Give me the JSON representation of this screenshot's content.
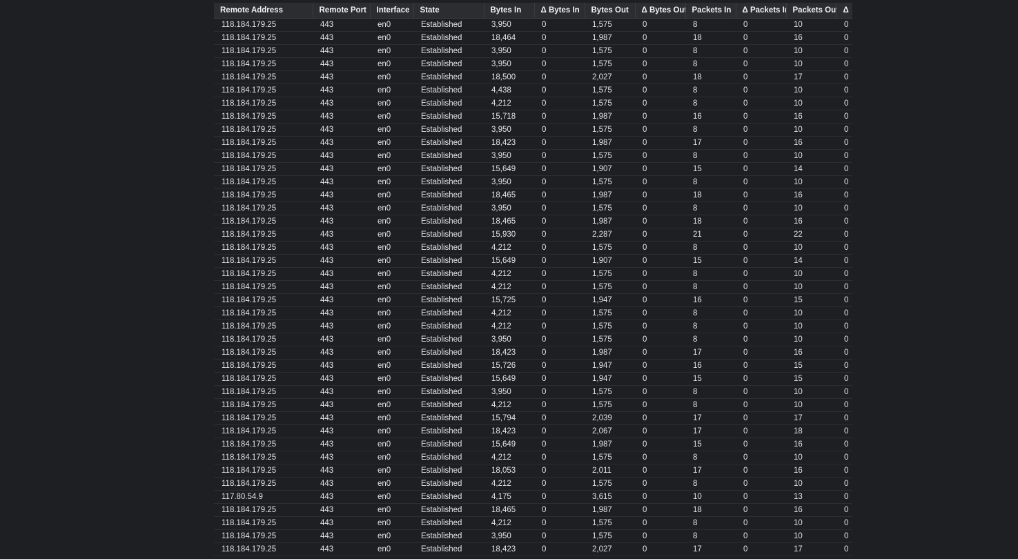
{
  "table": {
    "columns": [
      "Remote Address",
      "Remote Port",
      "Interface",
      "State",
      "Bytes In",
      "Δ Bytes In",
      "Bytes Out",
      "Δ Bytes Out",
      "Packets In",
      "Δ Packets In",
      "Packets Out",
      "Δ"
    ],
    "rows": [
      [
        "118.184.179.25",
        "443",
        "en0",
        "Established",
        "3,950",
        "0",
        "1,575",
        "0",
        "8",
        "0",
        "10",
        "0"
      ],
      [
        "118.184.179.25",
        "443",
        "en0",
        "Established",
        "18,464",
        "0",
        "1,987",
        "0",
        "18",
        "0",
        "16",
        "0"
      ],
      [
        "118.184.179.25",
        "443",
        "en0",
        "Established",
        "3,950",
        "0",
        "1,575",
        "0",
        "8",
        "0",
        "10",
        "0"
      ],
      [
        "118.184.179.25",
        "443",
        "en0",
        "Established",
        "3,950",
        "0",
        "1,575",
        "0",
        "8",
        "0",
        "10",
        "0"
      ],
      [
        "118.184.179.25",
        "443",
        "en0",
        "Established",
        "18,500",
        "0",
        "2,027",
        "0",
        "18",
        "0",
        "17",
        "0"
      ],
      [
        "118.184.179.25",
        "443",
        "en0",
        "Established",
        "4,438",
        "0",
        "1,575",
        "0",
        "8",
        "0",
        "10",
        "0"
      ],
      [
        "118.184.179.25",
        "443",
        "en0",
        "Established",
        "4,212",
        "0",
        "1,575",
        "0",
        "8",
        "0",
        "10",
        "0"
      ],
      [
        "118.184.179.25",
        "443",
        "en0",
        "Established",
        "15,718",
        "0",
        "1,987",
        "0",
        "16",
        "0",
        "16",
        "0"
      ],
      [
        "118.184.179.25",
        "443",
        "en0",
        "Established",
        "3,950",
        "0",
        "1,575",
        "0",
        "8",
        "0",
        "10",
        "0"
      ],
      [
        "118.184.179.25",
        "443",
        "en0",
        "Established",
        "18,423",
        "0",
        "1,987",
        "0",
        "17",
        "0",
        "16",
        "0"
      ],
      [
        "118.184.179.25",
        "443",
        "en0",
        "Established",
        "3,950",
        "0",
        "1,575",
        "0",
        "8",
        "0",
        "10",
        "0"
      ],
      [
        "118.184.179.25",
        "443",
        "en0",
        "Established",
        "15,649",
        "0",
        "1,907",
        "0",
        "15",
        "0",
        "14",
        "0"
      ],
      [
        "118.184.179.25",
        "443",
        "en0",
        "Established",
        "3,950",
        "0",
        "1,575",
        "0",
        "8",
        "0",
        "10",
        "0"
      ],
      [
        "118.184.179.25",
        "443",
        "en0",
        "Established",
        "18,465",
        "0",
        "1,987",
        "0",
        "18",
        "0",
        "16",
        "0"
      ],
      [
        "118.184.179.25",
        "443",
        "en0",
        "Established",
        "3,950",
        "0",
        "1,575",
        "0",
        "8",
        "0",
        "10",
        "0"
      ],
      [
        "118.184.179.25",
        "443",
        "en0",
        "Established",
        "18,465",
        "0",
        "1,987",
        "0",
        "18",
        "0",
        "16",
        "0"
      ],
      [
        "118.184.179.25",
        "443",
        "en0",
        "Established",
        "15,930",
        "0",
        "2,287",
        "0",
        "21",
        "0",
        "22",
        "0"
      ],
      [
        "118.184.179.25",
        "443",
        "en0",
        "Established",
        "4,212",
        "0",
        "1,575",
        "0",
        "8",
        "0",
        "10",
        "0"
      ],
      [
        "118.184.179.25",
        "443",
        "en0",
        "Established",
        "15,649",
        "0",
        "1,907",
        "0",
        "15",
        "0",
        "14",
        "0"
      ],
      [
        "118.184.179.25",
        "443",
        "en0",
        "Established",
        "4,212",
        "0",
        "1,575",
        "0",
        "8",
        "0",
        "10",
        "0"
      ],
      [
        "118.184.179.25",
        "443",
        "en0",
        "Established",
        "4,212",
        "0",
        "1,575",
        "0",
        "8",
        "0",
        "10",
        "0"
      ],
      [
        "118.184.179.25",
        "443",
        "en0",
        "Established",
        "15,725",
        "0",
        "1,947",
        "0",
        "16",
        "0",
        "15",
        "0"
      ],
      [
        "118.184.179.25",
        "443",
        "en0",
        "Established",
        "4,212",
        "0",
        "1,575",
        "0",
        "8",
        "0",
        "10",
        "0"
      ],
      [
        "118.184.179.25",
        "443",
        "en0",
        "Established",
        "4,212",
        "0",
        "1,575",
        "0",
        "8",
        "0",
        "10",
        "0"
      ],
      [
        "118.184.179.25",
        "443",
        "en0",
        "Established",
        "3,950",
        "0",
        "1,575",
        "0",
        "8",
        "0",
        "10",
        "0"
      ],
      [
        "118.184.179.25",
        "443",
        "en0",
        "Established",
        "18,423",
        "0",
        "1,987",
        "0",
        "17",
        "0",
        "16",
        "0"
      ],
      [
        "118.184.179.25",
        "443",
        "en0",
        "Established",
        "15,726",
        "0",
        "1,947",
        "0",
        "16",
        "0",
        "15",
        "0"
      ],
      [
        "118.184.179.25",
        "443",
        "en0",
        "Established",
        "15,649",
        "0",
        "1,947",
        "0",
        "15",
        "0",
        "15",
        "0"
      ],
      [
        "118.184.179.25",
        "443",
        "en0",
        "Established",
        "3,950",
        "0",
        "1,575",
        "0",
        "8",
        "0",
        "10",
        "0"
      ],
      [
        "118.184.179.25",
        "443",
        "en0",
        "Established",
        "4,212",
        "0",
        "1,575",
        "0",
        "8",
        "0",
        "10",
        "0"
      ],
      [
        "118.184.179.25",
        "443",
        "en0",
        "Established",
        "15,794",
        "0",
        "2,039",
        "0",
        "17",
        "0",
        "17",
        "0"
      ],
      [
        "118.184.179.25",
        "443",
        "en0",
        "Established",
        "18,423",
        "0",
        "2,067",
        "0",
        "17",
        "0",
        "18",
        "0"
      ],
      [
        "118.184.179.25",
        "443",
        "en0",
        "Established",
        "15,649",
        "0",
        "1,987",
        "0",
        "15",
        "0",
        "16",
        "0"
      ],
      [
        "118.184.179.25",
        "443",
        "en0",
        "Established",
        "4,212",
        "0",
        "1,575",
        "0",
        "8",
        "0",
        "10",
        "0"
      ],
      [
        "118.184.179.25",
        "443",
        "en0",
        "Established",
        "18,053",
        "0",
        "2,011",
        "0",
        "17",
        "0",
        "16",
        "0"
      ],
      [
        "118.184.179.25",
        "443",
        "en0",
        "Established",
        "4,212",
        "0",
        "1,575",
        "0",
        "8",
        "0",
        "10",
        "0"
      ],
      [
        "117.80.54.9",
        "443",
        "en0",
        "Established",
        "4,175",
        "0",
        "3,615",
        "0",
        "10",
        "0",
        "13",
        "0"
      ],
      [
        "118.184.179.25",
        "443",
        "en0",
        "Established",
        "18,465",
        "0",
        "1,987",
        "0",
        "18",
        "0",
        "16",
        "0"
      ],
      [
        "118.184.179.25",
        "443",
        "en0",
        "Established",
        "4,212",
        "0",
        "1,575",
        "0",
        "8",
        "0",
        "10",
        "0"
      ],
      [
        "118.184.179.25",
        "443",
        "en0",
        "Established",
        "3,950",
        "0",
        "1,575",
        "0",
        "8",
        "0",
        "10",
        "0"
      ],
      [
        "118.184.179.25",
        "443",
        "en0",
        "Established",
        "18,423",
        "0",
        "2,027",
        "0",
        "17",
        "0",
        "17",
        "0"
      ]
    ]
  }
}
